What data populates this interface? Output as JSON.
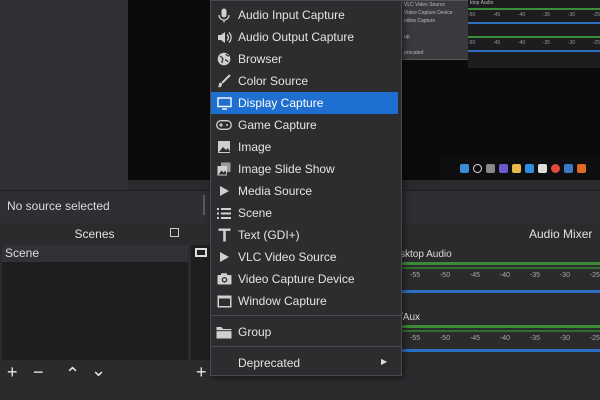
{
  "context_menu": {
    "items": [
      {
        "label": "Audio Input Capture",
        "icon": "microphone-icon"
      },
      {
        "label": "Audio Output Capture",
        "icon": "speaker-icon"
      },
      {
        "label": "Browser",
        "icon": "globe-icon"
      },
      {
        "label": "Color Source",
        "icon": "paint-brush-icon"
      },
      {
        "label": "Display Capture",
        "icon": "monitor-icon",
        "highlighted": true
      },
      {
        "label": "Game Capture",
        "icon": "gamepad-icon"
      },
      {
        "label": "Image",
        "icon": "image-icon"
      },
      {
        "label": "Image Slide Show",
        "icon": "slideshow-icon"
      },
      {
        "label": "Media Source",
        "icon": "play-icon"
      },
      {
        "label": "Scene",
        "icon": "list-icon"
      },
      {
        "label": "Text (GDI+)",
        "icon": "text-icon"
      },
      {
        "label": "VLC Video Source",
        "icon": "play-icon"
      },
      {
        "label": "Video Capture Device",
        "icon": "camera-icon"
      },
      {
        "label": "Window Capture",
        "icon": "window-icon"
      }
    ],
    "group": {
      "label": "Group",
      "icon": "folder-icon"
    },
    "deprecated": {
      "label": "Deprecated",
      "submenu_arrow": "▶"
    }
  },
  "source_bar": {
    "no_source": "No source selected"
  },
  "scenes": {
    "title": "Scenes",
    "items": [
      "Scene"
    ],
    "toolbar": [
      "+",
      "−",
      "⌃",
      "⌄"
    ]
  },
  "sources": {
    "toolbar": [
      "+"
    ]
  },
  "audio_mixer": {
    "title": "Audio Mixer",
    "channels": [
      {
        "name": "sktop Audio"
      },
      {
        "name": "/Aux"
      }
    ],
    "ticks": [
      "-55",
      "-50",
      "-45",
      "-40",
      "-35",
      "-30",
      "-25"
    ]
  },
  "nested_preview": {
    "menu_items": [
      "VLC Video Source",
      "Video Capture Device",
      "ndow Capture",
      "",
      "up",
      "",
      "precated"
    ],
    "mixer_label": "ktop Audio",
    "mixer_ticks": [
      "-50",
      "-45",
      "-40",
      "-35",
      "-30",
      "-25"
    ]
  },
  "colors": {
    "highlight": "#1f6fd1",
    "meter_green": "#3d8a37",
    "slider_blue": "#2a6fbf"
  }
}
